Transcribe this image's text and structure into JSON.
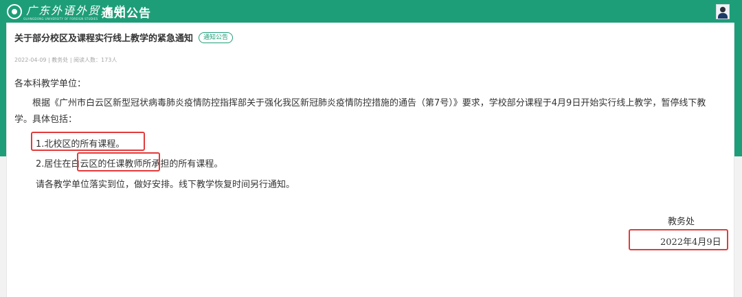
{
  "header": {
    "school_name": "广东外语外贸大学",
    "school_name_en": "GUANGDONG UNIVERSITY OF FOREIGN STUDIES",
    "module_title": "通知公告"
  },
  "notice": {
    "title": "关于部分校区及课程实行线上教学的紧急通知",
    "tag": "通知公告",
    "meta": "2022-04-09 | 教务处 | 阅读人数：173人",
    "greeting": "各本科教学单位：",
    "paragraph": "根据《广州市白云区新型冠状病毒肺炎疫情防控指挥部关于强化我区新冠肺炎疫情防控措施的通告（第7号）》要求，学校部分课程于4月9日开始实行线上教学，暂停线下教学。具体包括：",
    "item1": "1.北校区的所有课程。",
    "item2": "2.居住在白云区的任课教师所承担的所有课程。",
    "closing": "请各教学单位落实到位，做好安排。线下教学恢复时间另行通知。",
    "signature_dept": "教务处",
    "signature_date": "2022年4月9日"
  },
  "colors": {
    "brand": "#1e9e78",
    "highlight": "#e23a3a"
  },
  "icons": {
    "logo": "university-seal-icon",
    "avatar": "user-avatar-icon"
  }
}
